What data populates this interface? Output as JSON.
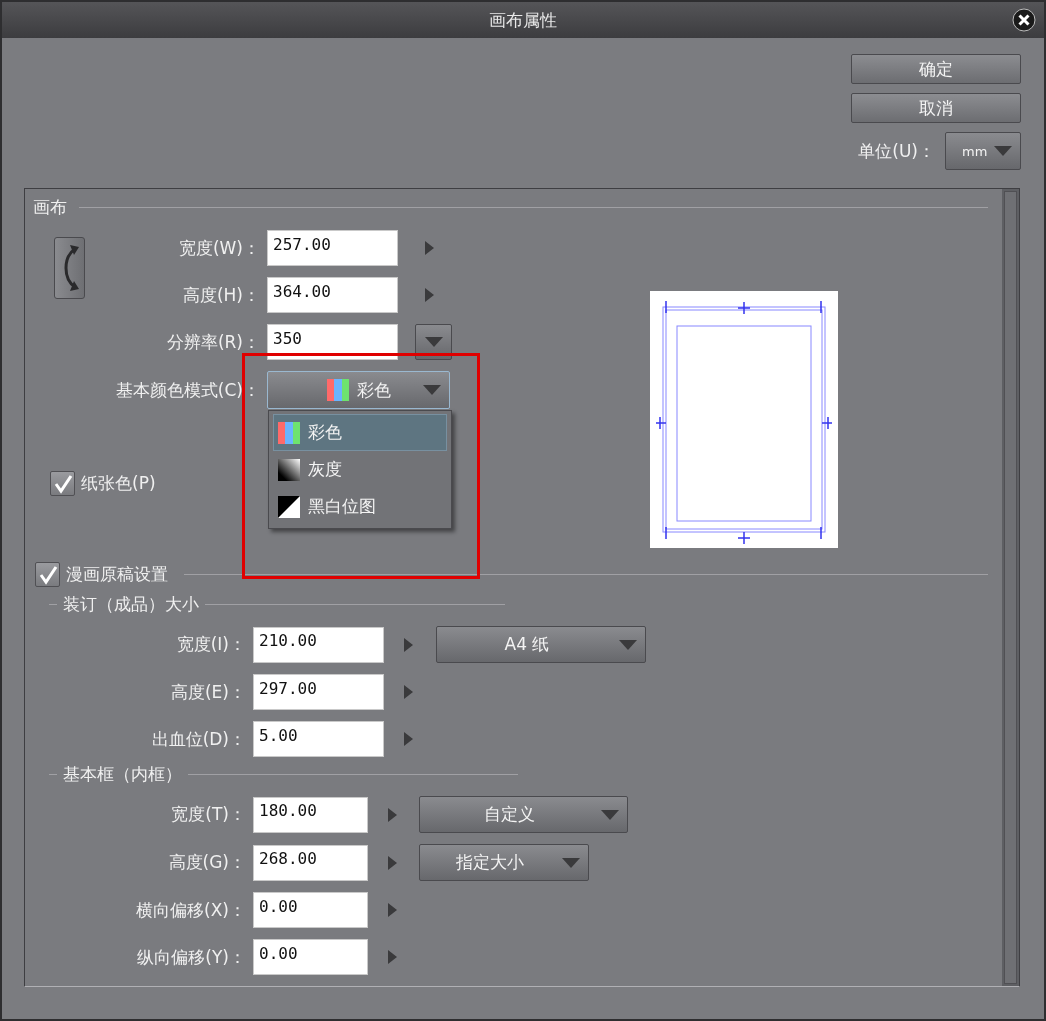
{
  "window": {
    "title": "画布属性"
  },
  "actions": [
    {
      "label": "确定"
    },
    {
      "label": "取消"
    }
  ],
  "unit": {
    "label": "单位(U)：",
    "value": "mm"
  },
  "canvas": {
    "title": "画布",
    "fields": [
      {
        "label": "宽度(W)：",
        "value": "257.00",
        "kind": "arrow"
      },
      {
        "label": "高度(H)：",
        "value": "364.00",
        "kind": "arrow"
      },
      {
        "label": "分辨率(R)：",
        "value": "350",
        "kind": "dropdown"
      }
    ],
    "color_mode": {
      "label": "基本颜色模式(C)：",
      "value": "彩色",
      "expanded": true,
      "options": [
        {
          "label": "彩色",
          "kind": "color",
          "selected": true
        },
        {
          "label": "灰度",
          "kind": "gray",
          "selected": false
        },
        {
          "label": "黑白位图",
          "kind": "mono",
          "selected": false
        }
      ]
    },
    "paper_color": {
      "label": "纸张色(P)",
      "checked": true
    }
  },
  "manga": {
    "label": "漫画原稿设置",
    "checked": true,
    "groups": [
      {
        "title": "装订（成品）大小",
        "fields": [
          {
            "label": "宽度(I)：",
            "value": "210.00",
            "preset": "A4 纸"
          },
          {
            "label": "高度(E)：",
            "value": "297.00"
          },
          {
            "label": "出血位(D)：",
            "value": "5.00"
          }
        ]
      },
      {
        "title": "基本框（内框）",
        "fields": [
          {
            "label": "宽度(T)：",
            "value": "180.00",
            "preset": "自定义"
          },
          {
            "label": "高度(G)：",
            "value": "268.00",
            "preset": "指定大小"
          },
          {
            "label": "横向偏移(X)：",
            "value": "0.00"
          },
          {
            "label": "纵向偏移(Y)：",
            "value": "0.00"
          }
        ]
      }
    ]
  }
}
